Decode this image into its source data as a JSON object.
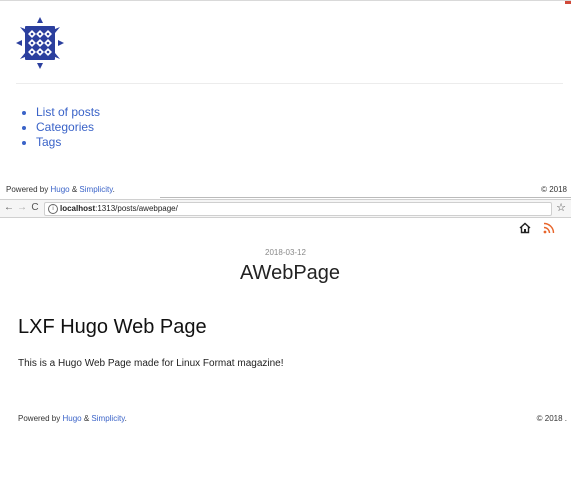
{
  "top_window": {
    "nav_items": [
      {
        "label": "List of posts"
      },
      {
        "label": "Categories"
      },
      {
        "label": "Tags"
      }
    ],
    "footer": {
      "powered_by": "Powered by",
      "hugo": "Hugo",
      "amp": "&",
      "simplicity": "Simplicity",
      "period": ".",
      "copyright": "© 2018"
    }
  },
  "address_bar": {
    "url_host": "localhost",
    "url_rest": ":1313/posts/awebpage/"
  },
  "page": {
    "date": "2018-03-12",
    "title": "AWebPage",
    "heading": "LXF Hugo Web Page",
    "body": "This is a Hugo Web Page made for Linux Format magazine!",
    "footer": {
      "powered_by": "Powered by",
      "hugo": "Hugo",
      "amp": "&",
      "simplicity": "Simplicity",
      "period": ".",
      "copyright": "© 2018 ."
    }
  },
  "colors": {
    "link": "#3a63c8",
    "logo": "#2b3f9e",
    "rss": "#e8652b"
  },
  "icons": {
    "logo": "site-logo-icon",
    "back": "back-arrow-icon",
    "forward": "forward-arrow-icon",
    "reload": "reload-icon",
    "info": "info-icon",
    "bookmark": "star-icon",
    "home": "home-icon",
    "rss": "rss-icon"
  }
}
